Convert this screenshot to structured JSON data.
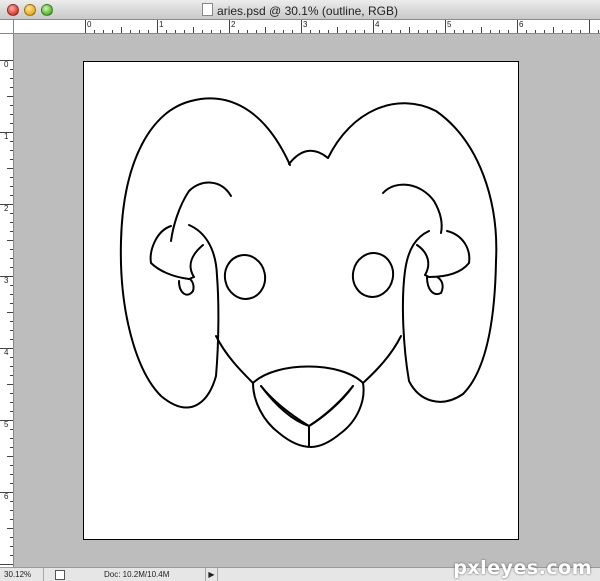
{
  "window": {
    "title": "aries.psd @ 30.1% (outline, RGB)",
    "controls": [
      "close",
      "minimize",
      "zoom"
    ]
  },
  "rulers": {
    "top_labels": [
      "0",
      "1",
      "2",
      "3",
      "4",
      "5",
      "6"
    ],
    "left_labels": [
      "0",
      "1",
      "2",
      "3",
      "4",
      "5",
      "6"
    ]
  },
  "status": {
    "zoom": "30.12%",
    "doc_info": "Doc: 10.2M/10.4M",
    "menu_arrow": "▶"
  },
  "watermark": "pxleyes.com",
  "colors": {
    "pasteboard": "#bdbdbd",
    "canvas": "#ffffff",
    "outline": "#000000"
  }
}
